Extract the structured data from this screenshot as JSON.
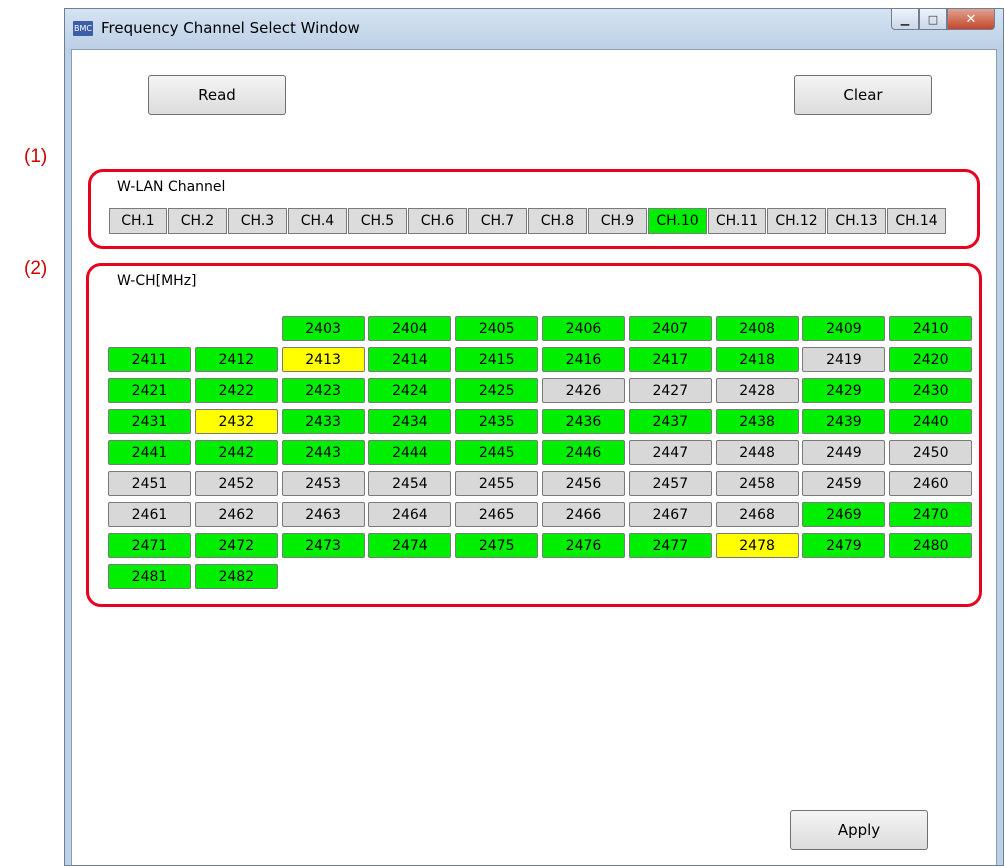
{
  "annotations": [
    "(1)",
    "(2)"
  ],
  "window": {
    "title": "Frequency Channel Select Window",
    "app_icon_text": "BMC",
    "controls": {
      "minimize": "▁",
      "maximize": "□",
      "close": "✕"
    }
  },
  "toolbar": {
    "read_label": "Read",
    "clear_label": "Clear",
    "apply_label": "Apply"
  },
  "wlan": {
    "label": "W-LAN Channel",
    "channels": [
      {
        "label": "CH.1",
        "state": "off"
      },
      {
        "label": "CH.2",
        "state": "off"
      },
      {
        "label": "CH.3",
        "state": "off"
      },
      {
        "label": "CH.4",
        "state": "off"
      },
      {
        "label": "CH.5",
        "state": "off"
      },
      {
        "label": "CH.6",
        "state": "off"
      },
      {
        "label": "CH.7",
        "state": "off"
      },
      {
        "label": "CH.8",
        "state": "off"
      },
      {
        "label": "CH.9",
        "state": "off"
      },
      {
        "label": "CH.10",
        "state": "on"
      },
      {
        "label": "CH.11",
        "state": "off"
      },
      {
        "label": "CH.12",
        "state": "off"
      },
      {
        "label": "CH.13",
        "state": "off"
      },
      {
        "label": "CH.14",
        "state": "off"
      }
    ]
  },
  "wch": {
    "label": "W-CH[MHz]",
    "first_frequency": 2403,
    "states": "GGGGGGGGGGYGGGGGNGGGGGGNNNGGGYGGGGGGGGGGGGGGNNNNNNNNNNNNNNNNNNNNNNGGGGGGGGGYGGGG",
    "colors": {
      "G": "#00ee00",
      "Y": "#ffff00",
      "N": "#d8d8d8"
    }
  }
}
